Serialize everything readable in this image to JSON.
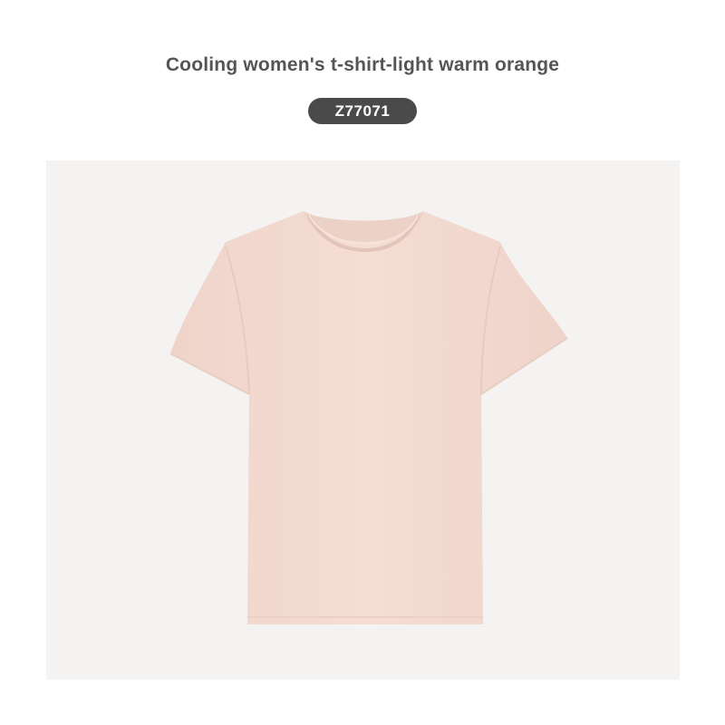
{
  "product": {
    "title": "Cooling women's t-shirt-light warm orange",
    "code": "Z77071",
    "garment_color": "#f3dbd2",
    "background_color": "#f4f3f2",
    "badge_color": "#4a4a4a"
  }
}
